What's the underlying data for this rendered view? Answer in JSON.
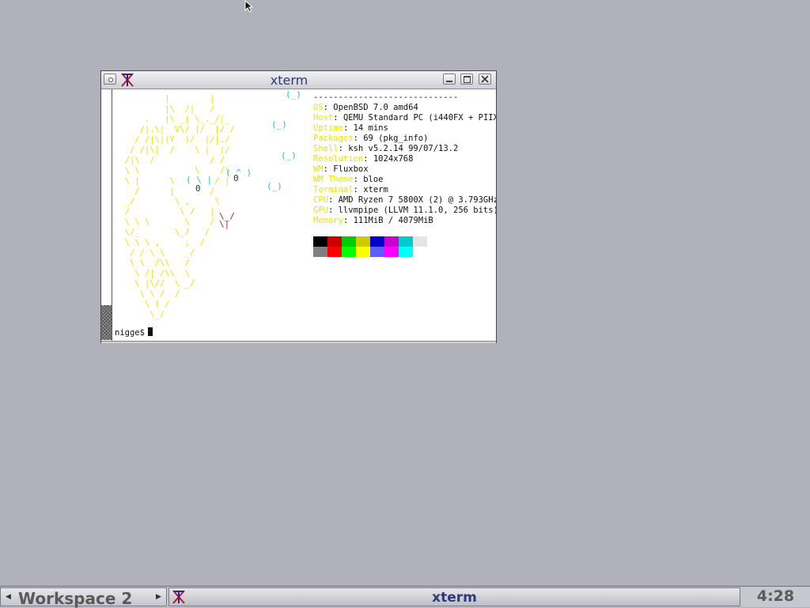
{
  "window": {
    "title": "xterm"
  },
  "terminal": {
    "ascii_art": "          |        |\n          |\\  /|   /\n      .   |\\ _| \\_._/|_\n     /|.\\|  V\\/ |/  |/ /\n    / /|\\|(Y  )/  |/|./\n   / /|\\|  /    \\ |  |/\n  /|\\  /           / /\n  \\ \\           \\    /\\\n  \\ |      \\        / |\n    /      |       /  \n  _/        \\ ,     \\\n  /          \\ /   |\n  \\ \\ \\       \\    /\n  \\/_       \\_/   /\n  \\ \\ \\ ,     ,  /\n   / / \\ \\    _/\n   \\ \\  /\\\\   /\n    \\ /| /\\\\  \\\n    \\ |\\//  \\ _/\n     \\ \\ /  /\n      \\ ( /\n       \\_/",
    "bubbles": [
      "(_)",
      "(_)",
      "(_)",
      "(_)"
    ],
    "eyes": [
      "0",
      "0"
    ],
    "mouth": "\\_/\n\\|",
    "info": [
      {
        "key": "",
        "value": "-----------------------------"
      },
      {
        "key": "OS",
        "value": ": OpenBSD 7.0 amd64"
      },
      {
        "key": "Host",
        "value": ": QEMU Standard PC (i440FX + PIIX"
      },
      {
        "key": "Uptime",
        "value": ": 14 mins"
      },
      {
        "key": "Packages",
        "value": ": 69 (pkg_info)"
      },
      {
        "key": "Shell",
        "value": ": ksh v5.2.14 99/07/13.2"
      },
      {
        "key": "Resolution",
        "value": ": 1024x768"
      },
      {
        "key": "WM",
        "value": ": Fluxbox"
      },
      {
        "key": "WM Theme",
        "value": ": bloe"
      },
      {
        "key": "Terminal",
        "value": ": xterm"
      },
      {
        "key": "CPU",
        "value": ": AMD Ryzen 7 5800X (2) @ 3.793GHz"
      },
      {
        "key": "GPU",
        "value": ": llvmpipe (LLVM 11.1.0, 256 bits)"
      },
      {
        "key": "Memory",
        "value": ": 111MiB / 4079MiB"
      }
    ],
    "palette_top": [
      "#000000",
      "#cc0000",
      "#00cc00",
      "#cccc00",
      "#0000cc",
      "#cc00cc",
      "#00cccc",
      "#e5e5e5"
    ],
    "palette_bottom": [
      "#7f7f7f",
      "#ff0000",
      "#00ff00",
      "#ffff00",
      "#5c5cff",
      "#ff00ff",
      "#00ffff",
      "#ffffff"
    ],
    "prompt": "nigge$"
  },
  "taskbar": {
    "workspace": "Workspace 2",
    "task_label": "xterm",
    "clock": "4:28"
  },
  "colors": {
    "desktop": "#b1b1ba",
    "title_text": "#2c3a78",
    "info_key": "#e6e600",
    "bubble": "#20c0c0"
  },
  "icons": {
    "cursor": "mouse-pointer-icon",
    "xterm": "xterm-x-icon",
    "menu": "window-menu-icon",
    "minimize": "minimize-icon",
    "maximize": "maximize-icon",
    "close": "close-icon"
  }
}
